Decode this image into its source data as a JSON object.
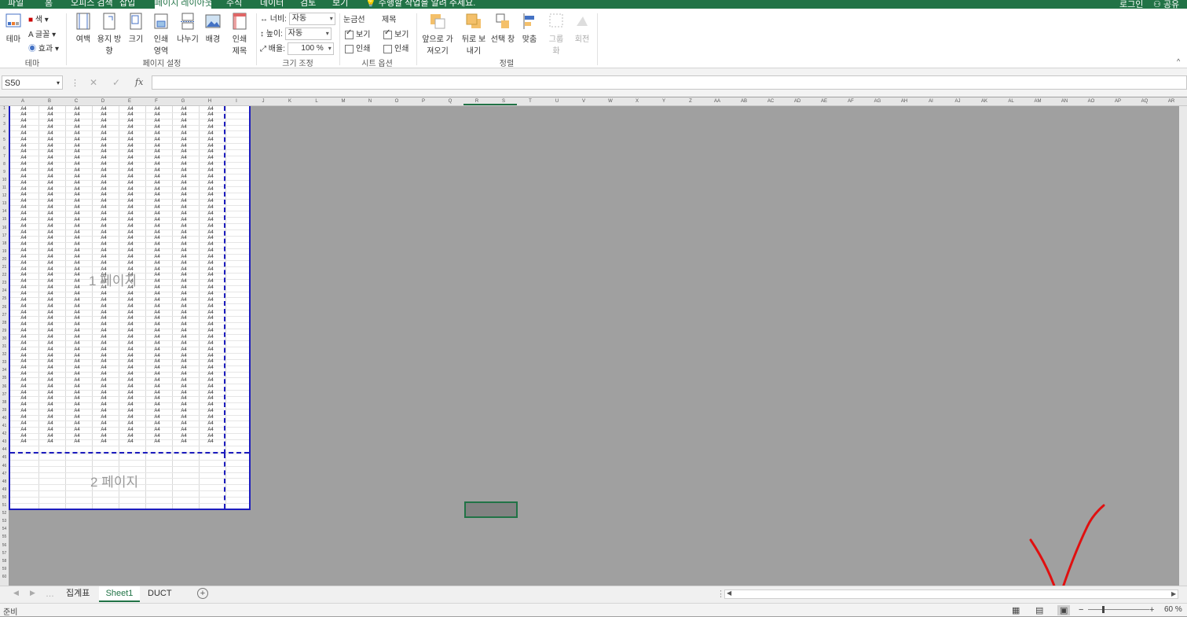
{
  "ribbon_tabs": [
    "파일",
    "홈",
    "오피스 검색",
    "삽입",
    "페이지 레이아웃",
    "수식",
    "데이터",
    "검토",
    "보기"
  ],
  "active_tab": "페이지 레이아웃",
  "tell_me": "수행할 작업을 알려 주세요.",
  "account": {
    "name": "로그인",
    "share": "공유"
  },
  "theme_group": {
    "label": "테마",
    "theme_btn": "테마",
    "colors": "색",
    "fonts": "글꼴",
    "effects": "효과"
  },
  "page_setup": {
    "label": "페이지 설정",
    "margins": "여백",
    "orientation": "용지 방향",
    "size": "크기",
    "print_area": "인쇄 영역",
    "breaks": "나누기",
    "background": "배경",
    "print_titles": "인쇄 제목"
  },
  "scale_group": {
    "label": "크기 조정",
    "width_label": "너비:",
    "width_value": "자동",
    "height_label": "높이:",
    "height_value": "자동",
    "scale_label": "배율:",
    "scale_value": "100 %"
  },
  "sheet_options": {
    "label": "시트 옵션",
    "gridlines": "눈금선",
    "headings": "제목",
    "view": "보기",
    "print": "인쇄"
  },
  "arrange": {
    "label": "정렬",
    "bring_forward": "앞으로 가져오기",
    "send_backward": "뒤로 보내기",
    "selection_pane": "선택 창",
    "align": "맞춤",
    "group": "그룹화",
    "rotate": "회전"
  },
  "name_box": "S50",
  "formula_value": "",
  "column_headers": [
    "A",
    "B",
    "C",
    "D",
    "E",
    "F",
    "G",
    "H",
    "I",
    "J",
    "K",
    "L",
    "M",
    "N",
    "O",
    "P",
    "Q",
    "R",
    "S",
    "T",
    "U",
    "V",
    "W",
    "X",
    "Y",
    "Z",
    "AA",
    "AB",
    "AC",
    "AD",
    "AE",
    "AF",
    "AG",
    "AH",
    "AI",
    "AJ",
    "AK",
    "AL",
    "AM",
    "AN",
    "AO",
    "AP",
    "AQ",
    "AR"
  ],
  "cell_text": "A4",
  "page_labels": [
    "1 페이지",
    "2 페이지"
  ],
  "sheet_tabs": [
    "집계표",
    "Sheet1",
    "DUCT"
  ],
  "active_sheet": "Sheet1",
  "status": {
    "ready": "준비",
    "zoom": "60 %"
  }
}
